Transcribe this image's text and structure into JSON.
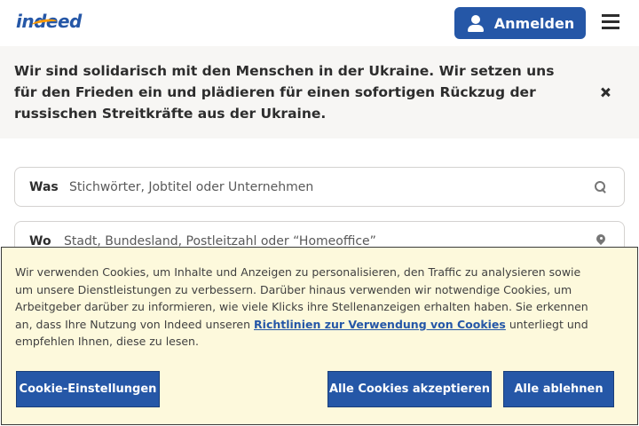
{
  "header": {
    "logo_text": "indeed",
    "login_label": "Anmelden",
    "icons": [
      "person-icon",
      "menu-icon"
    ]
  },
  "banner": {
    "text": "Wir sind solidarisch mit den Menschen in der Ukraine. Wir setzen uns für den Frieden ein und plädieren für einen sofortigen Rückzug der russischen Streitkräfte aus der Ukraine.",
    "close_icon": "close-icon"
  },
  "search": {
    "what_label": "Was",
    "what_placeholder": "Stichwörter, Jobtitel oder Unternehmen",
    "where_label": "Wo",
    "where_placeholder": "Stadt, Bundesland, Postleitzahl oder “Homeoffice”"
  },
  "cookie": {
    "text_before": "Wir verwenden Cookies, um Inhalte und Anzeigen zu personalisieren, den Traffic zu analysieren sowie um unsere Dienstleistungen zu verbessern. Darüber hinaus verwenden wir notwendige Cookies, um Arbeitgeber darüber zu informieren, wie viele Klicks ihre Stellenanzeigen erhalten haben. Sie erkennen an, dass Ihre Nutzung von Indeed unseren ",
    "link_text": "Richtlinien zur Verwendung von Cookies",
    "text_after": " unterliegt und empfehlen Ihnen, diese zu lesen.",
    "settings_label": "Cookie-Einstellungen",
    "accept_label": "Alle Cookies akzeptieren",
    "reject_label": "Alle ablehnen"
  },
  "colors": {
    "brand_blue": "#2557a7",
    "logo_orange": "#ff9a00",
    "banner_bg": "#f7f6f4",
    "cookie_bg": "#fdf9dc"
  }
}
